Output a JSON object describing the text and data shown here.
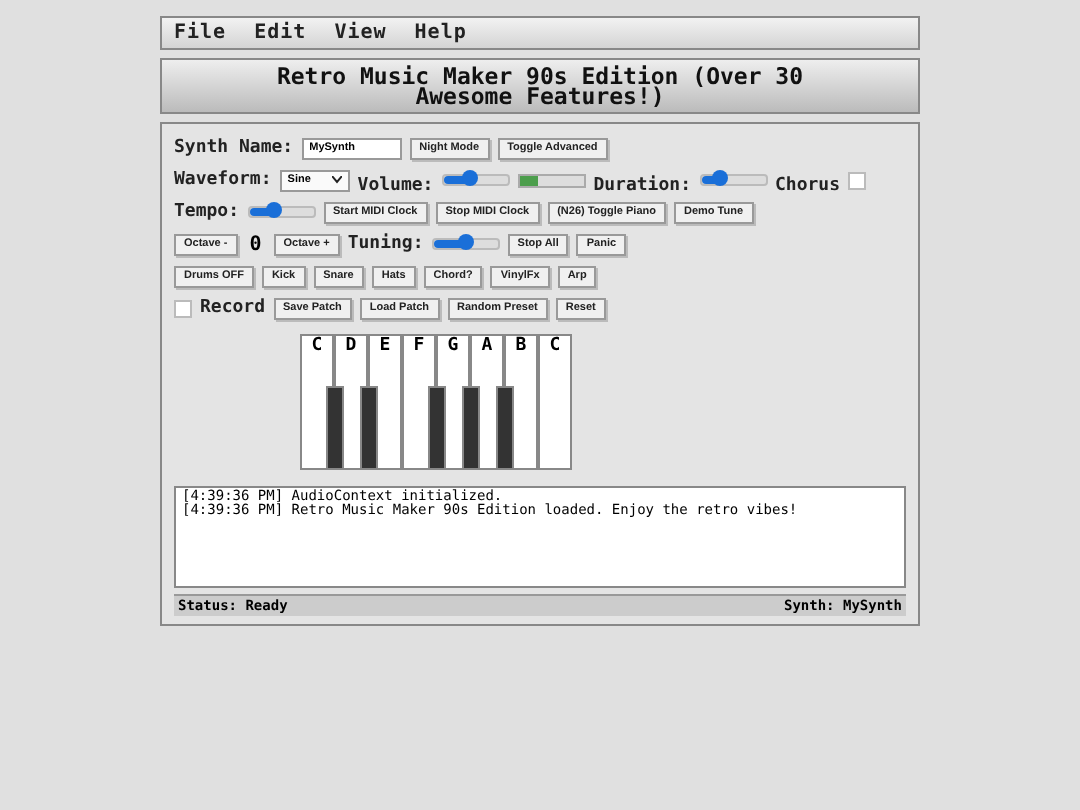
{
  "menu": [
    {
      "label": "File"
    },
    {
      "label": "Edit"
    },
    {
      "label": "View"
    },
    {
      "label": "Help"
    }
  ],
  "title": "Retro Music Maker 90s Edition (Over 30 Awesome Features!)",
  "rows": [
    [
      {
        "kind": "label",
        "text": "Synth Name:"
      },
      {
        "kind": "field",
        "value": "MySynth"
      },
      {
        "kind": "button",
        "text": "Night Mode"
      },
      {
        "kind": "button",
        "text": "Toggle Advanced"
      }
    ],
    [
      {
        "kind": "label",
        "text": "Waveform:"
      },
      {
        "kind": "select",
        "value": "Sine"
      },
      {
        "kind": "label",
        "text": "Volume:"
      },
      {
        "kind": "slider",
        "level": 0.4
      },
      {
        "kind": "meter",
        "level": 0.3
      },
      {
        "kind": "label",
        "text": "Duration:"
      },
      {
        "kind": "slider",
        "level": 0.3
      },
      {
        "kind": "label",
        "text": "Chorus"
      },
      {
        "kind": "checkbox",
        "checked": false
      }
    ],
    [
      {
        "kind": "label",
        "text": "Tempo:"
      },
      {
        "kind": "slider",
        "level": 0.4
      },
      {
        "kind": "button",
        "text": "Start MIDI Clock"
      },
      {
        "kind": "button",
        "text": "Stop MIDI Clock"
      },
      {
        "kind": "button",
        "text": "(N26) Toggle Piano"
      },
      {
        "kind": "button",
        "text": "Demo Tune"
      }
    ],
    [
      {
        "kind": "button",
        "text": "Octave -"
      },
      {
        "kind": "value",
        "text": "0"
      },
      {
        "kind": "button",
        "text": "Octave +"
      },
      {
        "kind": "label",
        "text": "Tuning:"
      },
      {
        "kind": "slider",
        "level": 0.5
      },
      {
        "kind": "button",
        "text": "Stop All"
      },
      {
        "kind": "button",
        "text": "Panic"
      }
    ],
    [
      {
        "kind": "button",
        "text": "Drums OFF"
      },
      {
        "kind": "button",
        "text": "Kick"
      },
      {
        "kind": "button",
        "text": "Snare"
      },
      {
        "kind": "button",
        "text": "Hats"
      },
      {
        "kind": "button",
        "text": "Chord?"
      },
      {
        "kind": "button",
        "text": "VinylFx"
      },
      {
        "kind": "button",
        "text": "Arp"
      }
    ],
    [
      {
        "kind": "checkbox",
        "checked": false
      },
      {
        "kind": "label",
        "text": "Record"
      },
      {
        "kind": "button",
        "text": "Save Patch"
      },
      {
        "kind": "button",
        "text": "Load Patch"
      },
      {
        "kind": "button",
        "text": "Random Preset"
      },
      {
        "kind": "button",
        "text": "Reset"
      }
    ]
  ],
  "piano": {
    "keys": [
      {
        "label": "C",
        "black_key": true
      },
      {
        "label": "D",
        "black_key": true
      },
      {
        "label": "E",
        "black_key": false
      },
      {
        "label": "F",
        "black_key": true
      },
      {
        "label": "G",
        "black_key": true
      },
      {
        "label": "A",
        "black_key": true
      },
      {
        "label": "B",
        "black_key": false
      },
      {
        "label": "C",
        "black_key": false
      }
    ]
  },
  "log": [
    "[4:39:36 PM] AudioContext initialized.",
    "[4:39:36 PM] Retro Music Maker 90s Edition loaded. Enjoy the retro vibes!"
  ],
  "status_bar": {
    "left": "Status: Ready",
    "right": "Synth: MySynth"
  }
}
